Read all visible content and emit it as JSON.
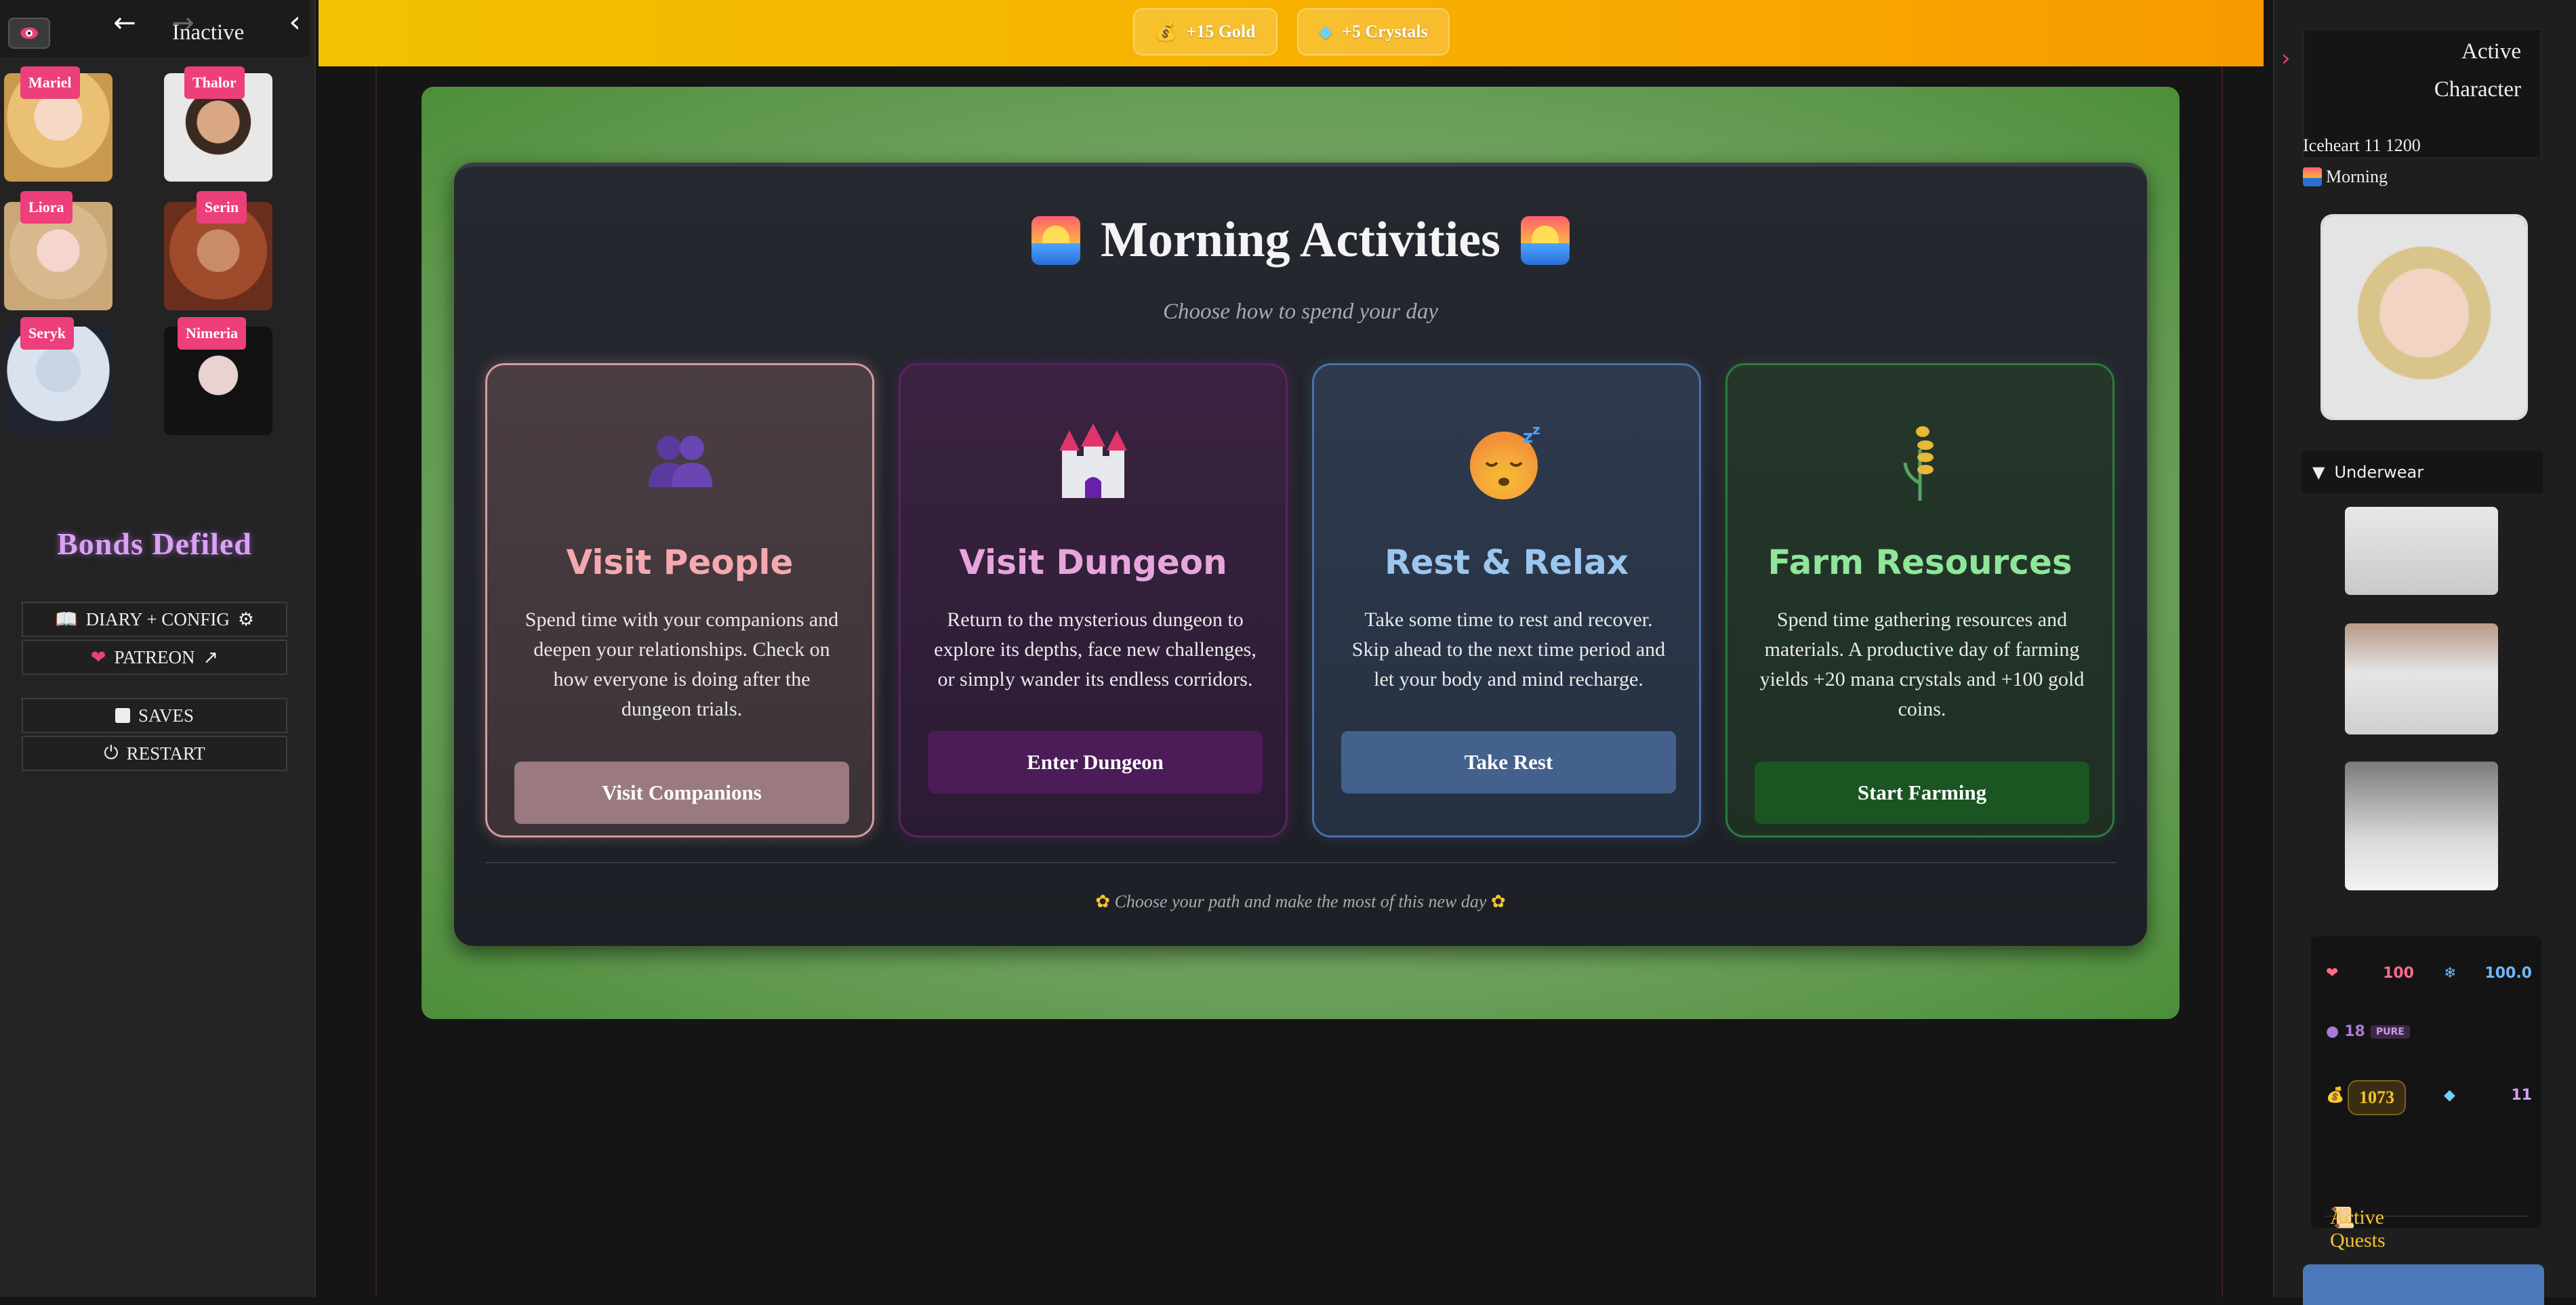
{
  "left_sidebar": {
    "status_label": "Inactive",
    "characters": [
      {
        "name": "Mariel"
      },
      {
        "name": "Thalor"
      },
      {
        "name": "Liora"
      },
      {
        "name": "Serin"
      },
      {
        "name": "Seryk"
      },
      {
        "name": "Nimeria"
      }
    ],
    "brand": "Bonds Defiled",
    "menu": {
      "diary_config": "DIARY + CONFIG",
      "patreon": "PATREON",
      "saves": "SAVES",
      "restart": "RESTART"
    }
  },
  "rewards": {
    "gold": "+15 Gold",
    "crystals": "+5 Crystals"
  },
  "activities": {
    "title": "Morning Activities",
    "subtitle": "Choose how to spend your day",
    "footer": "Choose your path and make the most of this new day",
    "cards": [
      {
        "title": "Visit People",
        "description": "Spend time with your companions and deepen your relationships. Check on how everyone is doing after the dungeon trials.",
        "button": "Visit Companions"
      },
      {
        "title": "Visit Dungeon",
        "description": "Return to the mysterious dungeon to explore its depths, face new challenges, or simply wander its endless corridors.",
        "button": "Enter Dungeon"
      },
      {
        "title": "Rest & Relax",
        "description": "Take some time to rest and recover. Skip ahead to the next time period and let your body and mind recharge.",
        "button": "Take Rest"
      },
      {
        "title": "Farm Resources",
        "description": "Spend time gathering resources and materials. A productive day of farming yields +20 mana crystals and +100 gold coins.",
        "button": "Start Farming"
      }
    ]
  },
  "right_sidebar": {
    "active_line1": "Active",
    "active_line2": "Character",
    "location": "Iceheart 11 1200",
    "time_of_day": "Morning",
    "underwear_header": "Underwear",
    "stats": {
      "health": "100",
      "mana": "100.0",
      "purity_value": "18",
      "purity_label": "PURE",
      "gold": "1073",
      "crystals": "11"
    },
    "quests_label": "Active Quests"
  },
  "colors": {
    "accent_pink": "#ec3f7b",
    "banner_gold": "#f7b200",
    "brand_purple": "#d9a2f2",
    "gold_text": "#f4c430"
  }
}
